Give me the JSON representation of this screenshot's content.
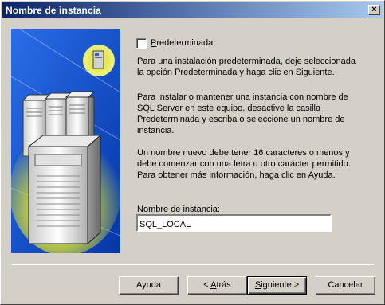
{
  "window": {
    "title": "Nombre de instancia",
    "close_label": "×"
  },
  "default_option": {
    "label": "Predeterminada",
    "checked": false
  },
  "paragraphs": [
    "Para una instalación predeterminada, deje seleccionada la opción Predeterminada y haga clic en Siguiente.",
    "Para instalar o mantener una instancia con nombre de SQL Server en este equipo, desactive la casilla Predeterminada y escriba o seleccione un nombre de instancia.",
    "Un nombre nuevo debe tener 16 caracteres o menos y debe comenzar con una letra u otro carácter permitido. Para obtener más información, haga clic en Ayuda."
  ],
  "instance": {
    "label": "Nombre de instancia:",
    "value": "SQL_LOCAL"
  },
  "buttons": {
    "help": "Ayuda",
    "back": "< Atrás",
    "next": "Siguiente >",
    "cancel": "Cancelar"
  },
  "colors": {
    "art_background": "#0a44c4",
    "title_active": "#0a246a"
  }
}
